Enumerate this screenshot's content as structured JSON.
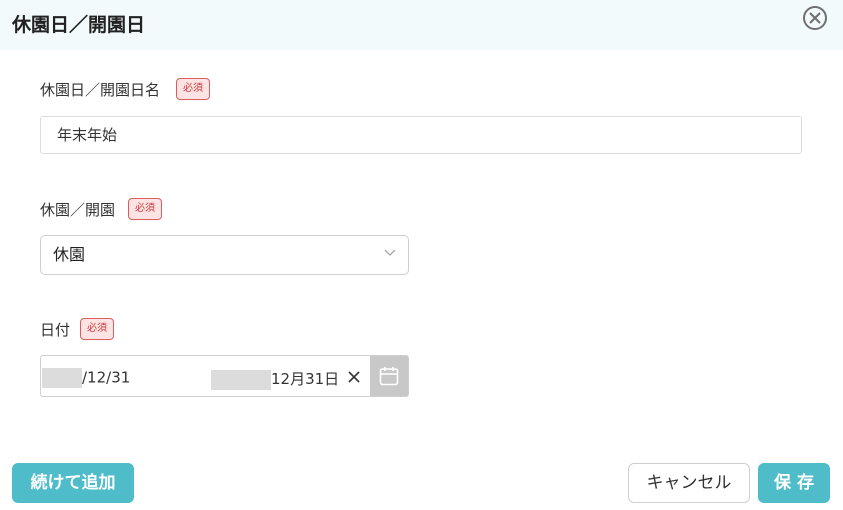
{
  "dialog": {
    "title": "休園日／開園日"
  },
  "fields": {
    "name": {
      "label": "休園日／開園日名",
      "badge": "必須",
      "value": "年末年始"
    },
    "type": {
      "label": "休園／開園",
      "badge": "必須",
      "selected": "休園"
    },
    "date": {
      "label": "日付",
      "badge": "必須",
      "start_value": "/12/31",
      "end_value": "12月31日"
    }
  },
  "footer": {
    "continue_label": "続けて追加",
    "cancel_label": "キャンセル",
    "save_label": "保 存"
  },
  "colors": {
    "accent": "#4fbcc9",
    "header_bg": "#f3fafc",
    "badge_border": "#e05b5b",
    "badge_bg": "#fde3e3"
  }
}
